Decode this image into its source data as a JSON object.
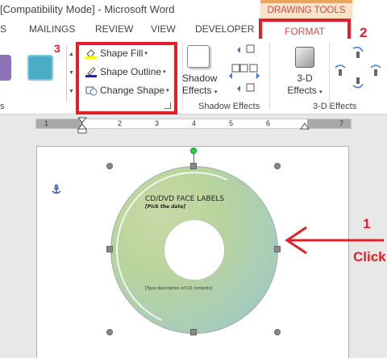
{
  "titlebar": {
    "title": "[Compatibility Mode] - Microsoft Word",
    "contextual_group": "DRAWING TOOLS"
  },
  "tabs": {
    "items": [
      "S",
      "MAILINGS",
      "REVIEW",
      "VIEW",
      "DEVELOPER"
    ],
    "active": "FORMAT"
  },
  "shape_styles": {
    "swatch_colors": [
      "#8e72b8",
      "#4bacc6"
    ],
    "fill_label": "Shape Fill",
    "outline_label": "Shape Outline",
    "change_label": "Change Shape"
  },
  "shadow_effects": {
    "button_line1": "Shadow",
    "button_line2": "Effects",
    "group_label": "Shadow Effects"
  },
  "three_d_effects": {
    "button_line1": "3-D",
    "button_line2": "Effects",
    "group_label": "3-D Effects"
  },
  "ruler": {
    "numbers": [
      "1",
      "1",
      "2",
      "3",
      "4",
      "5",
      "6",
      "7"
    ]
  },
  "document": {
    "cd_title": "CD/DVD FACE LABELS",
    "cd_date": "[Pick the date]",
    "cd_description": "[Type description of CD contents]"
  },
  "annotations": {
    "callout_1": "1",
    "callout_1_text": "Click",
    "callout_2": "2",
    "callout_3": "3",
    "accent_color": "#e0202a"
  }
}
